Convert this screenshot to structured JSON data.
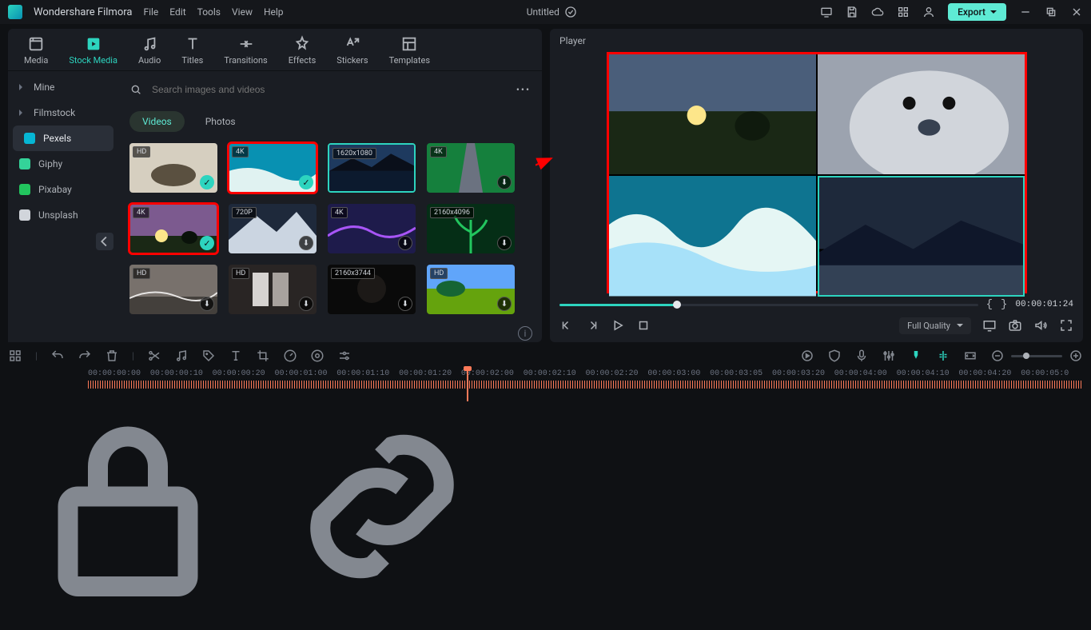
{
  "titlebar": {
    "app_name": "Wondershare Filmora",
    "menu": [
      "File",
      "Edit",
      "Tools",
      "View",
      "Help"
    ],
    "doc_title": "Untitled",
    "export_label": "Export"
  },
  "tabs": [
    {
      "label": "Media",
      "icon": "media"
    },
    {
      "label": "Stock Media",
      "icon": "stock",
      "active": true
    },
    {
      "label": "Audio",
      "icon": "audio"
    },
    {
      "label": "Titles",
      "icon": "titles"
    },
    {
      "label": "Transitions",
      "icon": "transitions"
    },
    {
      "label": "Effects",
      "icon": "effects"
    },
    {
      "label": "Stickers",
      "icon": "stickers"
    },
    {
      "label": "Templates",
      "icon": "templates"
    }
  ],
  "sidebar": [
    {
      "label": "Mine",
      "caret": true
    },
    {
      "label": "Filmstock",
      "caret": true
    },
    {
      "label": "Pexels",
      "active": true,
      "icon_color": "#06b6d4"
    },
    {
      "label": "Giphy",
      "icon_color": "#34d399"
    },
    {
      "label": "Pixabay",
      "icon_color": "#22c55e"
    },
    {
      "label": "Unsplash",
      "icon_color": "#d1d5db"
    }
  ],
  "search_placeholder": "Search images and videos",
  "filters": [
    {
      "label": "Videos",
      "active": true
    },
    {
      "label": "Photos"
    }
  ],
  "thumbs": [
    {
      "badge": "HD",
      "checked": true,
      "scene": "turtle"
    },
    {
      "badge": "4K",
      "checked": true,
      "redbox": true,
      "scene": "beach"
    },
    {
      "badge": "1620x1080",
      "selected": true,
      "scene": "lake"
    },
    {
      "badge": "4K",
      "dl": true,
      "scene": "road"
    },
    {
      "badge": "4K",
      "checked": true,
      "redbox": true,
      "scene": "sunset"
    },
    {
      "badge": "720P",
      "dl": true,
      "scene": "mountain"
    },
    {
      "badge": "4K",
      "dl": true,
      "scene": "neon"
    },
    {
      "badge": "2160x4096",
      "dl": true,
      "scene": "plant"
    },
    {
      "badge": "HD",
      "dl": true,
      "scene": "rocks"
    },
    {
      "badge": "HD",
      "dl": true,
      "scene": "books"
    },
    {
      "badge": "2160x3744",
      "dl": true,
      "scene": "dark"
    },
    {
      "badge": "HD",
      "dl": true,
      "scene": "field"
    }
  ],
  "player": {
    "label": "Player",
    "timecode": "00:00:01:24",
    "quality": "Full Quality"
  },
  "timeline": {
    "labels": [
      "00:00:00:00",
      "00:00:00:10",
      "00:00:00:20",
      "00:00:01:00",
      "00:00:01:10",
      "00:00:01:20",
      "00:00:02:00",
      "00:00:02:10",
      "00:00:02:20",
      "00:00:03:00",
      "00:00:03:05",
      "00:00:03:20",
      "00:00:04:00",
      "00:00:04:10",
      "00:00:04:20",
      "00:00:05:0"
    ]
  }
}
